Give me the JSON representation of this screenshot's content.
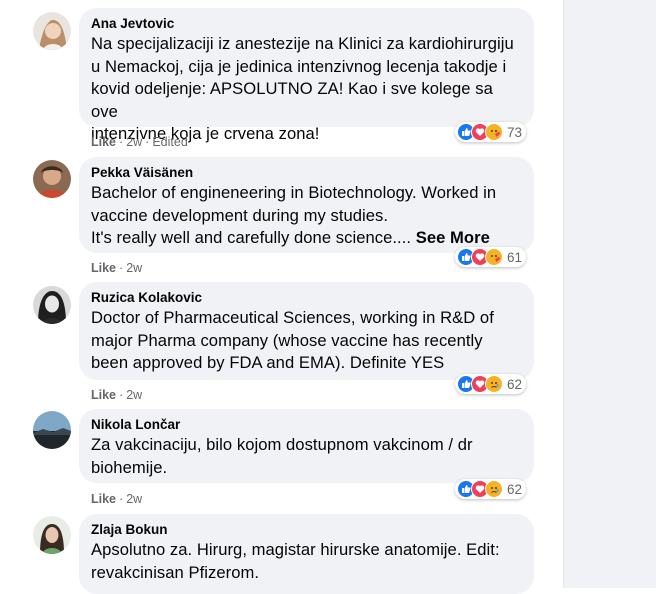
{
  "comments": [
    {
      "author": "Ana Jevtovic",
      "lines": [
        "Na specijalizaciji iz anestezije na Klinici za kardiohirurgiju",
        "u Nemackoj, cija je jedinica intenzivnog lecenja takodje i",
        "kovid odeljenje: APSOLUTNO ZA! Kao i sve kolege sa ove",
        "intenzivne koja je crvena zona!"
      ],
      "like_label": "Like",
      "time": "2w",
      "edited": "Edited",
      "reaction_count": "73",
      "reaction_icons": [
        "like-icon",
        "love-icon",
        "care-icon"
      ]
    },
    {
      "author": "Pekka Väisänen",
      "lines": [
        "Bachelor of engineneering in Biotechnology. Worked in",
        "vaccine development during my studies.",
        "It's really well and carefully done science...."
      ],
      "see_more": "See More",
      "like_label": "Like",
      "time": "2w",
      "reaction_count": "61",
      "reaction_icons": [
        "like-icon",
        "love-icon",
        "care-icon"
      ]
    },
    {
      "author": "Ruzica Kolakovic",
      "lines": [
        "Doctor of Pharmaceutical Sciences, working in R&D of",
        "major Pharma company (whose vaccine has recently",
        "been approved by FDA and EMA). Definite YES"
      ],
      "like_label": "Like",
      "time": "2w",
      "reaction_count": "62",
      "reaction_icons": [
        "like-icon",
        "love-icon",
        "sad-icon"
      ]
    },
    {
      "author": "Nikola Lončar",
      "lines": [
        "Za vakcinaciju, bilo kojom dostupnom vakcinom / dr",
        "biohemije."
      ],
      "like_label": "Like",
      "time": "2w",
      "reaction_count": "62",
      "reaction_icons": [
        "like-icon",
        "love-icon",
        "sad-icon"
      ]
    },
    {
      "author": "Zlaja Bokun",
      "lines": [
        "Apsolutno za. Hirurg, magistar hirurske anatomije. Edit:",
        "revakcinisan Pfizerom."
      ]
    }
  ],
  "separator": "·",
  "colors": {
    "bubble": "#f0f2f5",
    "secondary_text": "#65676b",
    "like_blue": "#1877f2",
    "love_red": "#f33e58",
    "emoji_yellow": "#f7b125"
  }
}
